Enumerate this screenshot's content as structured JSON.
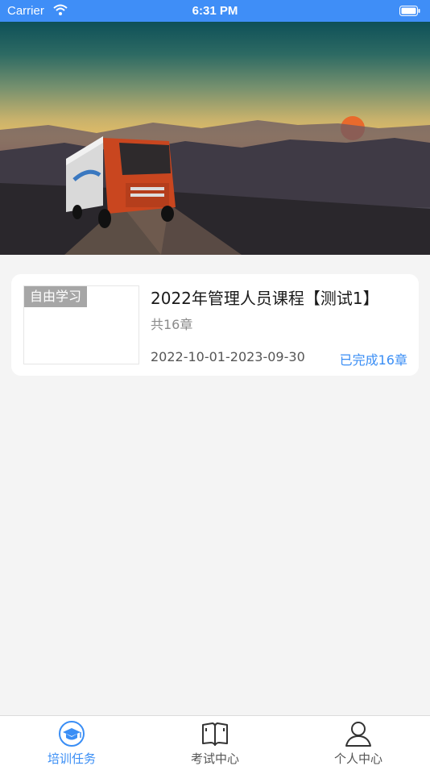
{
  "status_bar": {
    "carrier": "Carrier",
    "time": "6:31 PM"
  },
  "banner": {
    "icon": "truck-landscape-image"
  },
  "course": {
    "tag": "自由学习",
    "title": "2022年管理人员课程【测试1】",
    "chapters": "共16章",
    "date_range": "2022-10-01-2023-09-30",
    "completed": "已完成16章"
  },
  "tab_bar": {
    "tabs": [
      {
        "label": "培训任务",
        "icon": "graduation-cap-icon",
        "active": true
      },
      {
        "label": "考试中心",
        "icon": "open-book-icon",
        "active": false
      },
      {
        "label": "个人中心",
        "icon": "person-icon",
        "active": false
      }
    ]
  },
  "colors": {
    "accent": "#3a8ef5",
    "status_bar": "#3f8ef7",
    "background": "#f4f4f4",
    "tag_bg": "#a6a6a6"
  }
}
